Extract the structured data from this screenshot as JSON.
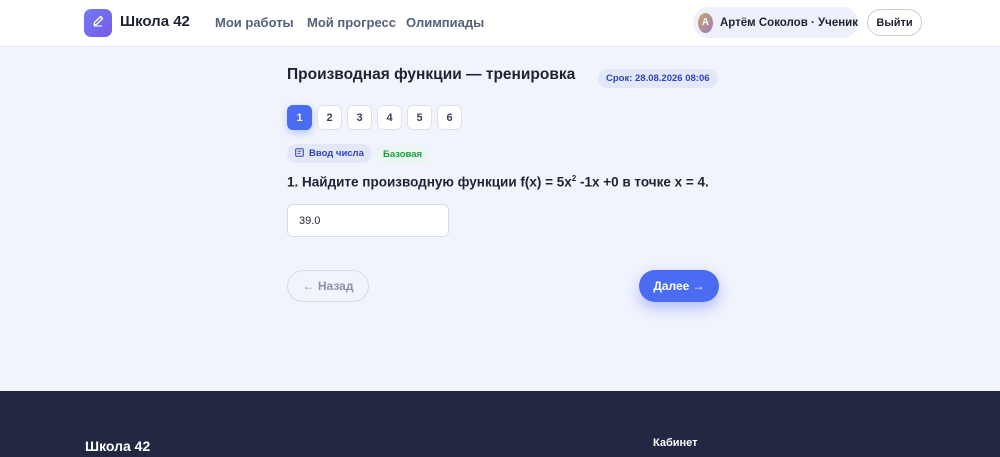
{
  "header": {
    "brand": "Школа 42",
    "nav": [
      "Мои работы",
      "Мой прогресс",
      "Олимпиады"
    ],
    "user": {
      "initial": "А",
      "label": "Артём Соколов · Ученик"
    },
    "logout_label": "Выйти"
  },
  "task": {
    "title": "Производная функции — тренировка",
    "deadline": "Срок: 28.08.2026 08:06",
    "questions": [
      "1",
      "2",
      "3",
      "4",
      "5",
      "6"
    ],
    "active_question": "1",
    "type_tag": "Ввод числа",
    "level_tag": "Базовая",
    "question_prefix": "1. Найдите производную функции f(x) = 5x",
    "question_sup": "2",
    "question_suffix": " -1x +0 в точке x = 4.",
    "answer_value": "39.0",
    "back_label": "← Назад",
    "next_label": "Далее →"
  },
  "footer": {
    "brand": "Школа 42",
    "column_title": "Кабинет"
  },
  "colors": {
    "accent": "#4a6cf2",
    "background": "#f1f4fd",
    "footer": "#222841",
    "level_green": "#1f9a4a"
  }
}
